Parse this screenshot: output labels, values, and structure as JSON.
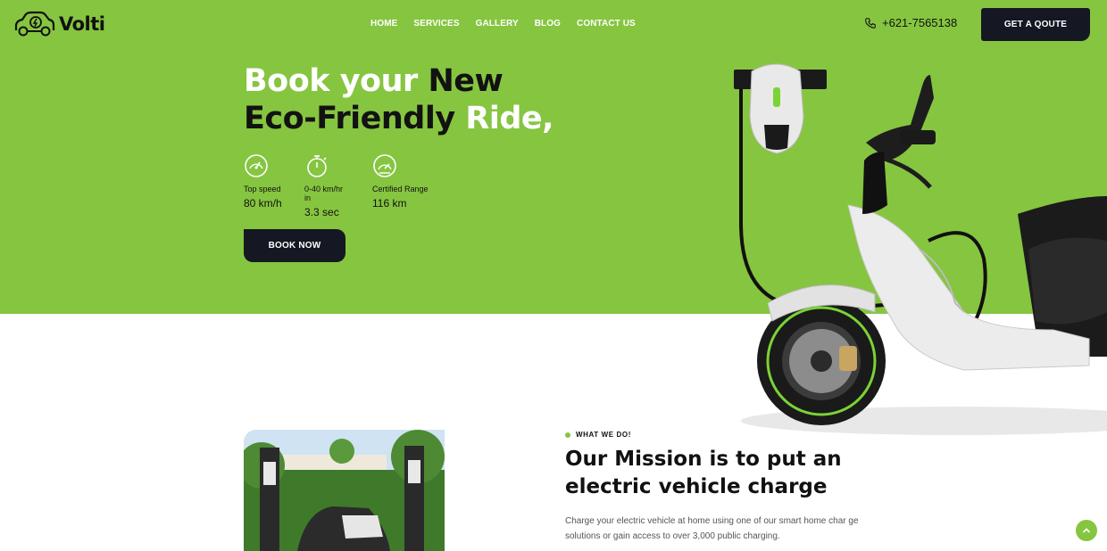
{
  "header": {
    "logo_text": "Volti",
    "nav": [
      "HOME",
      "SERVICES",
      "GALLERY",
      "BLOG",
      "CONTACT US"
    ],
    "phone": "+621-7565138",
    "cta_label": "GET A QOUTE"
  },
  "hero": {
    "title_line1_a": "Book your ",
    "title_line1_b": "New",
    "title_line2_a": "Eco-Friendly ",
    "title_line2_b": "Ride,",
    "stats": [
      {
        "label": "Top speed",
        "value": "80 km/h",
        "icon": "speedometer-icon"
      },
      {
        "label": "0-40 km/hr in",
        "value": "3.3 sec",
        "icon": "stopwatch-icon"
      },
      {
        "label": "Certified Range",
        "value": "116 km",
        "icon": "gauge-icon"
      }
    ],
    "book_label": "BOOK NOW"
  },
  "mission": {
    "eyebrow": "WHAT WE DO!",
    "title_line1": "Our Mission is to put an",
    "title_line2": "electric vehicle charge",
    "description_line1": "Charge your electric vehicle at home using one of our smart home char ge",
    "description_line2": "solutions or gain access to over 3,000 public charging."
  },
  "colors": {
    "brand_green": "#86c540",
    "dark": "#151823"
  }
}
